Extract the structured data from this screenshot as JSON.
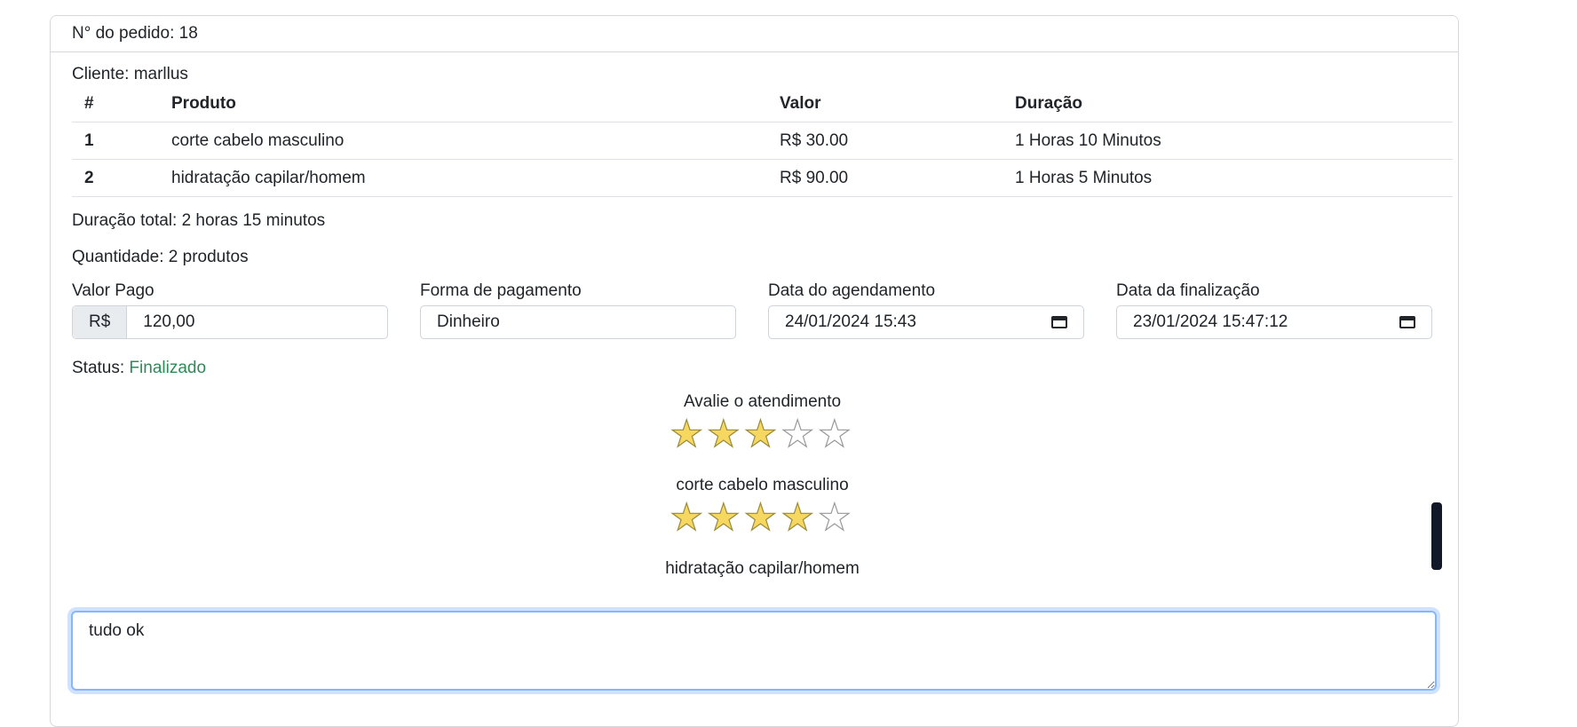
{
  "order": {
    "number_label": "N° do pedido: 18",
    "client_label": "Cliente: marllus"
  },
  "table": {
    "headers": [
      "#",
      "Produto",
      "Valor",
      "Duração"
    ],
    "rows": [
      [
        "1",
        "corte cabelo masculino",
        "R$ 30.00",
        "1 Horas 10 Minutos"
      ],
      [
        "2",
        "hidratação capilar/homem",
        "R$ 90.00",
        "1 Horas 5 Minutos"
      ]
    ]
  },
  "summary": {
    "duration_total": "Duração total: 2 horas 15 minutos",
    "quantity": "Quantidade: 2 produtos"
  },
  "fields": {
    "valor_pago": {
      "label": "Valor Pago",
      "prefix": "R$",
      "value": "120,00"
    },
    "forma_pagamento": {
      "label": "Forma de pagamento",
      "value": "Dinheiro"
    },
    "data_agendamento": {
      "label": "Data do agendamento",
      "value": "24/01/2024 15:43"
    },
    "data_finalizacao": {
      "label": "Data da finalização",
      "value": "23/01/2024 15:47:12"
    }
  },
  "status": {
    "label": "Status: ",
    "value": "Finalizado",
    "color": "#2e8b57"
  },
  "ratings": [
    {
      "title": "Avalie o atendimento",
      "stars": 3,
      "max": 5
    },
    {
      "title": "corte cabelo masculino",
      "stars": 4,
      "max": 5
    },
    {
      "title": "hidratação capilar/homem"
    }
  ],
  "comment": {
    "value": "tudo ok"
  },
  "icons": {
    "calendar": "calendar-icon",
    "star": "star-icon"
  }
}
